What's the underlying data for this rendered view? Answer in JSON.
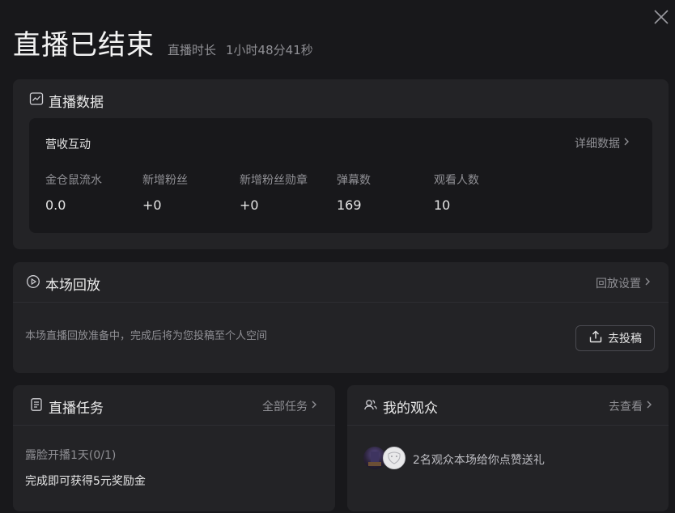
{
  "header": {
    "title": "直播已结束",
    "duration_label": "直播时长",
    "duration_value": "1小时48分41秒"
  },
  "live_data": {
    "title": "直播数据",
    "section_title": "营收互动",
    "detail_link": "详细数据",
    "stats": [
      {
        "label": "金仓鼠流水",
        "value": "0.0"
      },
      {
        "label": "新增粉丝",
        "value": "+0"
      },
      {
        "label": "新增粉丝勋章",
        "value": "+0"
      },
      {
        "label": "弹幕数",
        "value": "169"
      },
      {
        "label": "观看人数",
        "value": "10"
      }
    ]
  },
  "replay": {
    "title": "本场回放",
    "settings_link": "回放设置",
    "description": "本场直播回放准备中，完成后将为您投稿至个人空间",
    "upload_button": "去投稿"
  },
  "tasks": {
    "title": "直播任务",
    "all_link": "全部任务",
    "task_name": "露脸开播1天(0/1)",
    "task_reward": "完成即可获得5元奖励金"
  },
  "audience": {
    "title": "我的观众",
    "view_link": "去查看",
    "summary": "2名观众本场给你点赞送礼"
  },
  "colors": {
    "background": "#18181b",
    "card": "#232326",
    "muted_text": "#8f8f94"
  }
}
